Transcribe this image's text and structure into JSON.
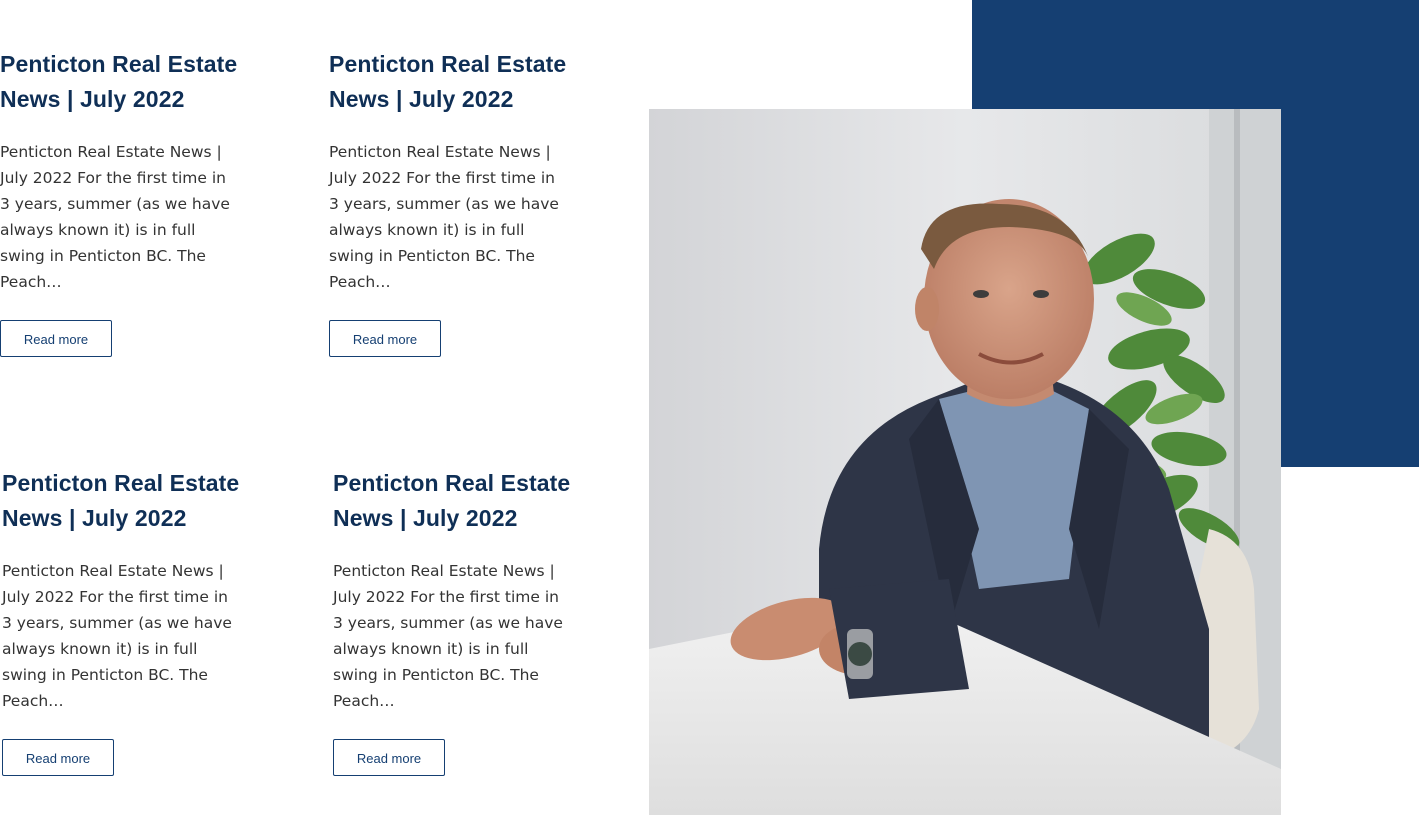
{
  "posts": [
    {
      "title": "Penticton Real Estate News | July 2022",
      "excerpt": "Penticton Real Estate News | July 2022 For the first time in 3 years, summer (as we have always known it) is in full swing in Penticton BC. The Peach…",
      "button_label": "Read more"
    },
    {
      "title": "Penticton Real Estate News | July 2022",
      "excerpt": "Penticton Real Estate News | July 2022 For the first time in 3 years, summer (as we have always known it) is in full swing in Penticton BC. The Peach…",
      "button_label": "Read more"
    },
    {
      "title": "Penticton Real Estate News | July 2022",
      "excerpt": "Penticton Real Estate News | July 2022 For the first time in 3 years, summer (as we have always known it) is in full swing in Penticton BC. The Peach…",
      "button_label": "Read more"
    },
    {
      "title": "Penticton Real Estate News | July 2022",
      "excerpt": "Penticton Real Estate News | July 2022 For the first time in 3 years, summer (as we have always known it) is in full swing in Penticton BC. The Peach…",
      "button_label": "Read more"
    }
  ],
  "colors": {
    "brand_blue": "#153f72",
    "heading": "#0f2f56",
    "body_text": "#333333"
  },
  "photo": {
    "subject": "agent-portrait"
  }
}
